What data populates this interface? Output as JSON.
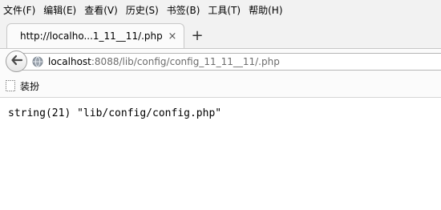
{
  "menu": {
    "items": [
      "文件(F)",
      "编辑(E)",
      "查看(V)",
      "历史(S)",
      "书签(B)",
      "工具(T)",
      "帮助(H)"
    ]
  },
  "tab": {
    "title": "http://localho...1_11__11/.php",
    "close_glyph": "×",
    "new_tab_glyph": "+"
  },
  "nav": {
    "url_host": "localhost",
    "url_rest": ":8088/lib/config/config_11_11__11/.php"
  },
  "bookmarks": {
    "items": [
      {
        "label": "装扮",
        "icon": "bookmark-page-icon"
      }
    ]
  },
  "page": {
    "output": "string(21) \"lib/config/config.php\""
  }
}
